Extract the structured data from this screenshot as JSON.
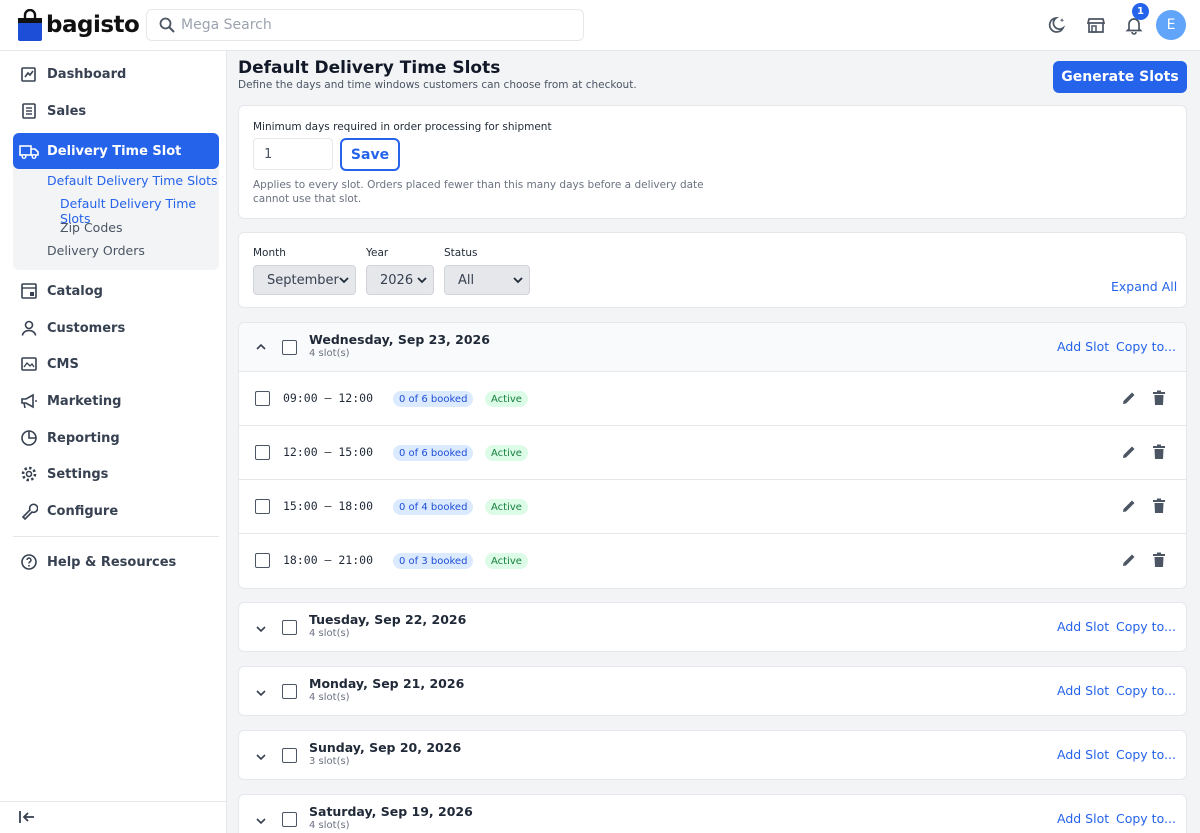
{
  "header": {
    "logo_text": "bagisto",
    "search_placeholder": "Mega Search",
    "notification_count": "1",
    "avatar_initial": "E"
  },
  "sidebar": {
    "items": [
      {
        "label": "Dashboard",
        "icon": "dashboard-icon"
      },
      {
        "label": "Sales",
        "icon": "sales-icon"
      },
      {
        "label": "Delivery Time Slot",
        "icon": "truck-icon",
        "active": true
      },
      {
        "label": "Catalog",
        "icon": "catalog-icon"
      },
      {
        "label": "Customers",
        "icon": "person-icon"
      },
      {
        "label": "CMS",
        "icon": "cms-icon"
      },
      {
        "label": "Marketing",
        "icon": "megaphone-icon"
      },
      {
        "label": "Reporting",
        "icon": "chart-pie-icon"
      },
      {
        "label": "Settings",
        "icon": "gear-icon"
      },
      {
        "label": "Configure",
        "icon": "wrench-icon"
      },
      {
        "label": "Help & Resources",
        "icon": "help-icon"
      }
    ],
    "sub_items": [
      {
        "label": "Default Delivery Time Slots"
      },
      {
        "label": "Default Delivery Time Slots"
      },
      {
        "label": "Zip Codes"
      },
      {
        "label": "Delivery Orders"
      }
    ]
  },
  "page": {
    "title": "Default Delivery Time Slots",
    "subtitle": "Define the days and time windows customers can choose from at checkout.",
    "generate_label": "Generate Slots"
  },
  "settings": {
    "min_days_label": "Minimum days required in order processing for shipment",
    "min_days_value": "1",
    "save_label": "Save",
    "help_text": "Applies to every slot. Orders placed fewer than this many days before a delivery date cannot use that slot."
  },
  "filters": {
    "month_label": "Month",
    "month_value": "September",
    "year_label": "Year",
    "year_value": "2026",
    "status_label": "Status",
    "status_value": "All",
    "expand_all": "Expand All"
  },
  "day_actions": {
    "add_slot": "Add Slot",
    "copy_to": "Copy to..."
  },
  "days": [
    {
      "title": "Wednesday, Sep 23, 2026",
      "count": "4 slot(s)",
      "expanded": true,
      "slots": [
        {
          "time": "09:00 – 12:00",
          "booked": "0 of 6 booked",
          "status": "Active"
        },
        {
          "time": "12:00 – 15:00",
          "booked": "0 of 6 booked",
          "status": "Active"
        },
        {
          "time": "15:00 – 18:00",
          "booked": "0 of 4 booked",
          "status": "Active"
        },
        {
          "time": "18:00 – 21:00",
          "booked": "0 of 3 booked",
          "status": "Active"
        }
      ]
    },
    {
      "title": "Tuesday, Sep 22, 2026",
      "count": "4 slot(s)"
    },
    {
      "title": "Monday, Sep 21, 2026",
      "count": "4 slot(s)"
    },
    {
      "title": "Sunday, Sep 20, 2026",
      "count": "3 slot(s)"
    },
    {
      "title": "Saturday, Sep 19, 2026",
      "count": "4 slot(s)"
    }
  ],
  "colors": {
    "accent": "#2563eb",
    "active_green": "#15803d",
    "booked_blue": "#1d4ed8"
  }
}
